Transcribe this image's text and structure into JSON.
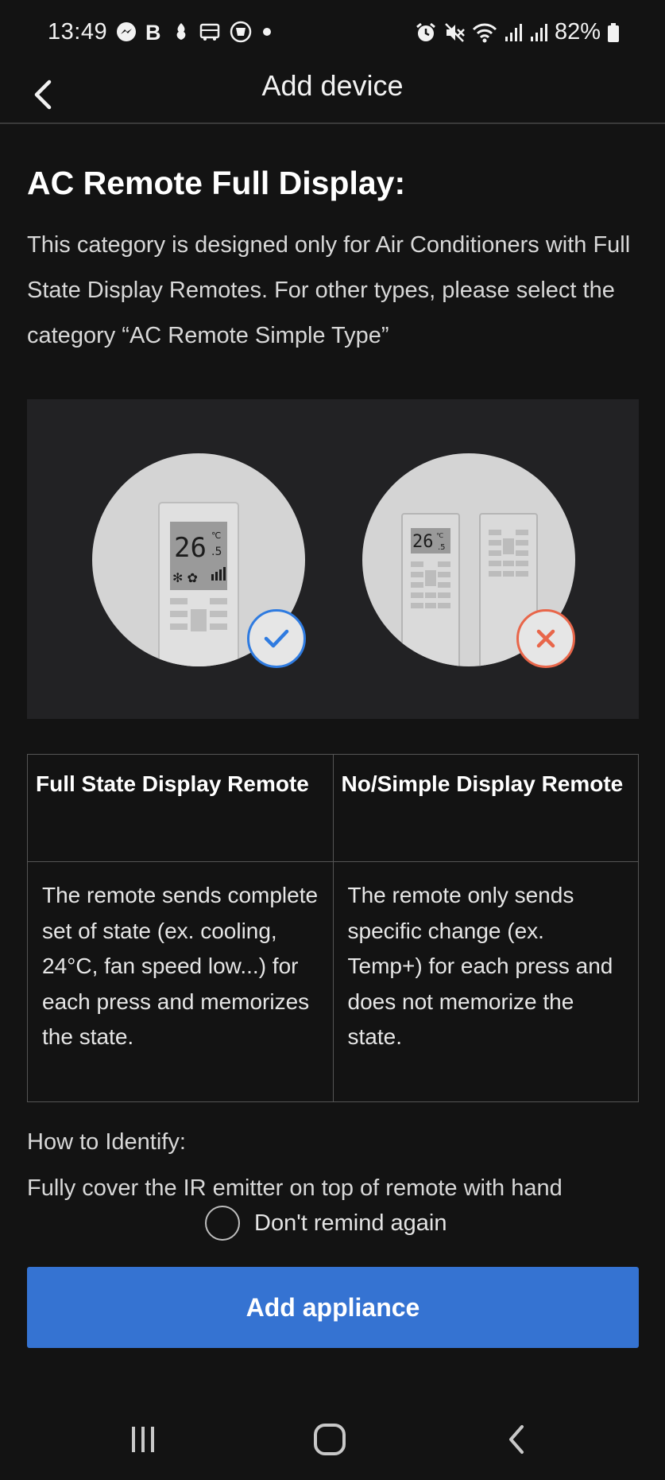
{
  "status_bar": {
    "time": "13:49",
    "left_icons": [
      "messenger-icon",
      "b-app-icon",
      "notification-icon",
      "bus-icon",
      "emblem-icon",
      "dot-icon"
    ],
    "right_icons": [
      "alarm-icon",
      "mute-icon",
      "wifi-icon",
      "signal-icon",
      "signal-icon"
    ],
    "battery": "82%"
  },
  "app_bar": {
    "title": "Add device",
    "back_icon": "chevron-left-icon"
  },
  "content": {
    "heading": "AC Remote Full Display:",
    "intro": "This category is designed only for Air Conditioners with Full State Display Remotes. For other types, please select the category “AC Remote Simple Type”"
  },
  "illustration": {
    "left_display_temp": "26",
    "left_display_unit": "℃",
    "left_display_fraction": ".5",
    "right_display_temp": "26",
    "right_display_unit": "℃",
    "right_display_fraction": ".5",
    "ok_icon": "check-icon",
    "no_icon": "close-icon",
    "colors": {
      "ok": "#2f7be0",
      "no": "#e8664a"
    }
  },
  "comparison": {
    "headers": [
      "Full State Display Remote",
      "No/Simple Display Remote"
    ],
    "descriptions": [
      "The remote sends complete set of state (ex. cooling, 24°C, fan speed low...) for each press and memorizes the state.",
      "The remote only sends specific change (ex. Temp+) for each press and does not memorize the state."
    ]
  },
  "identify": {
    "label": "How to Identify:",
    "text": "Fully cover the IR emitter on top of remote with hand"
  },
  "remind": {
    "label": "Don't remind again",
    "checked": false
  },
  "primary_button": {
    "label": "Add appliance",
    "color": "#3573d2"
  },
  "nav_bar": {
    "icons": [
      "recents-icon",
      "home-icon",
      "back-icon"
    ]
  }
}
